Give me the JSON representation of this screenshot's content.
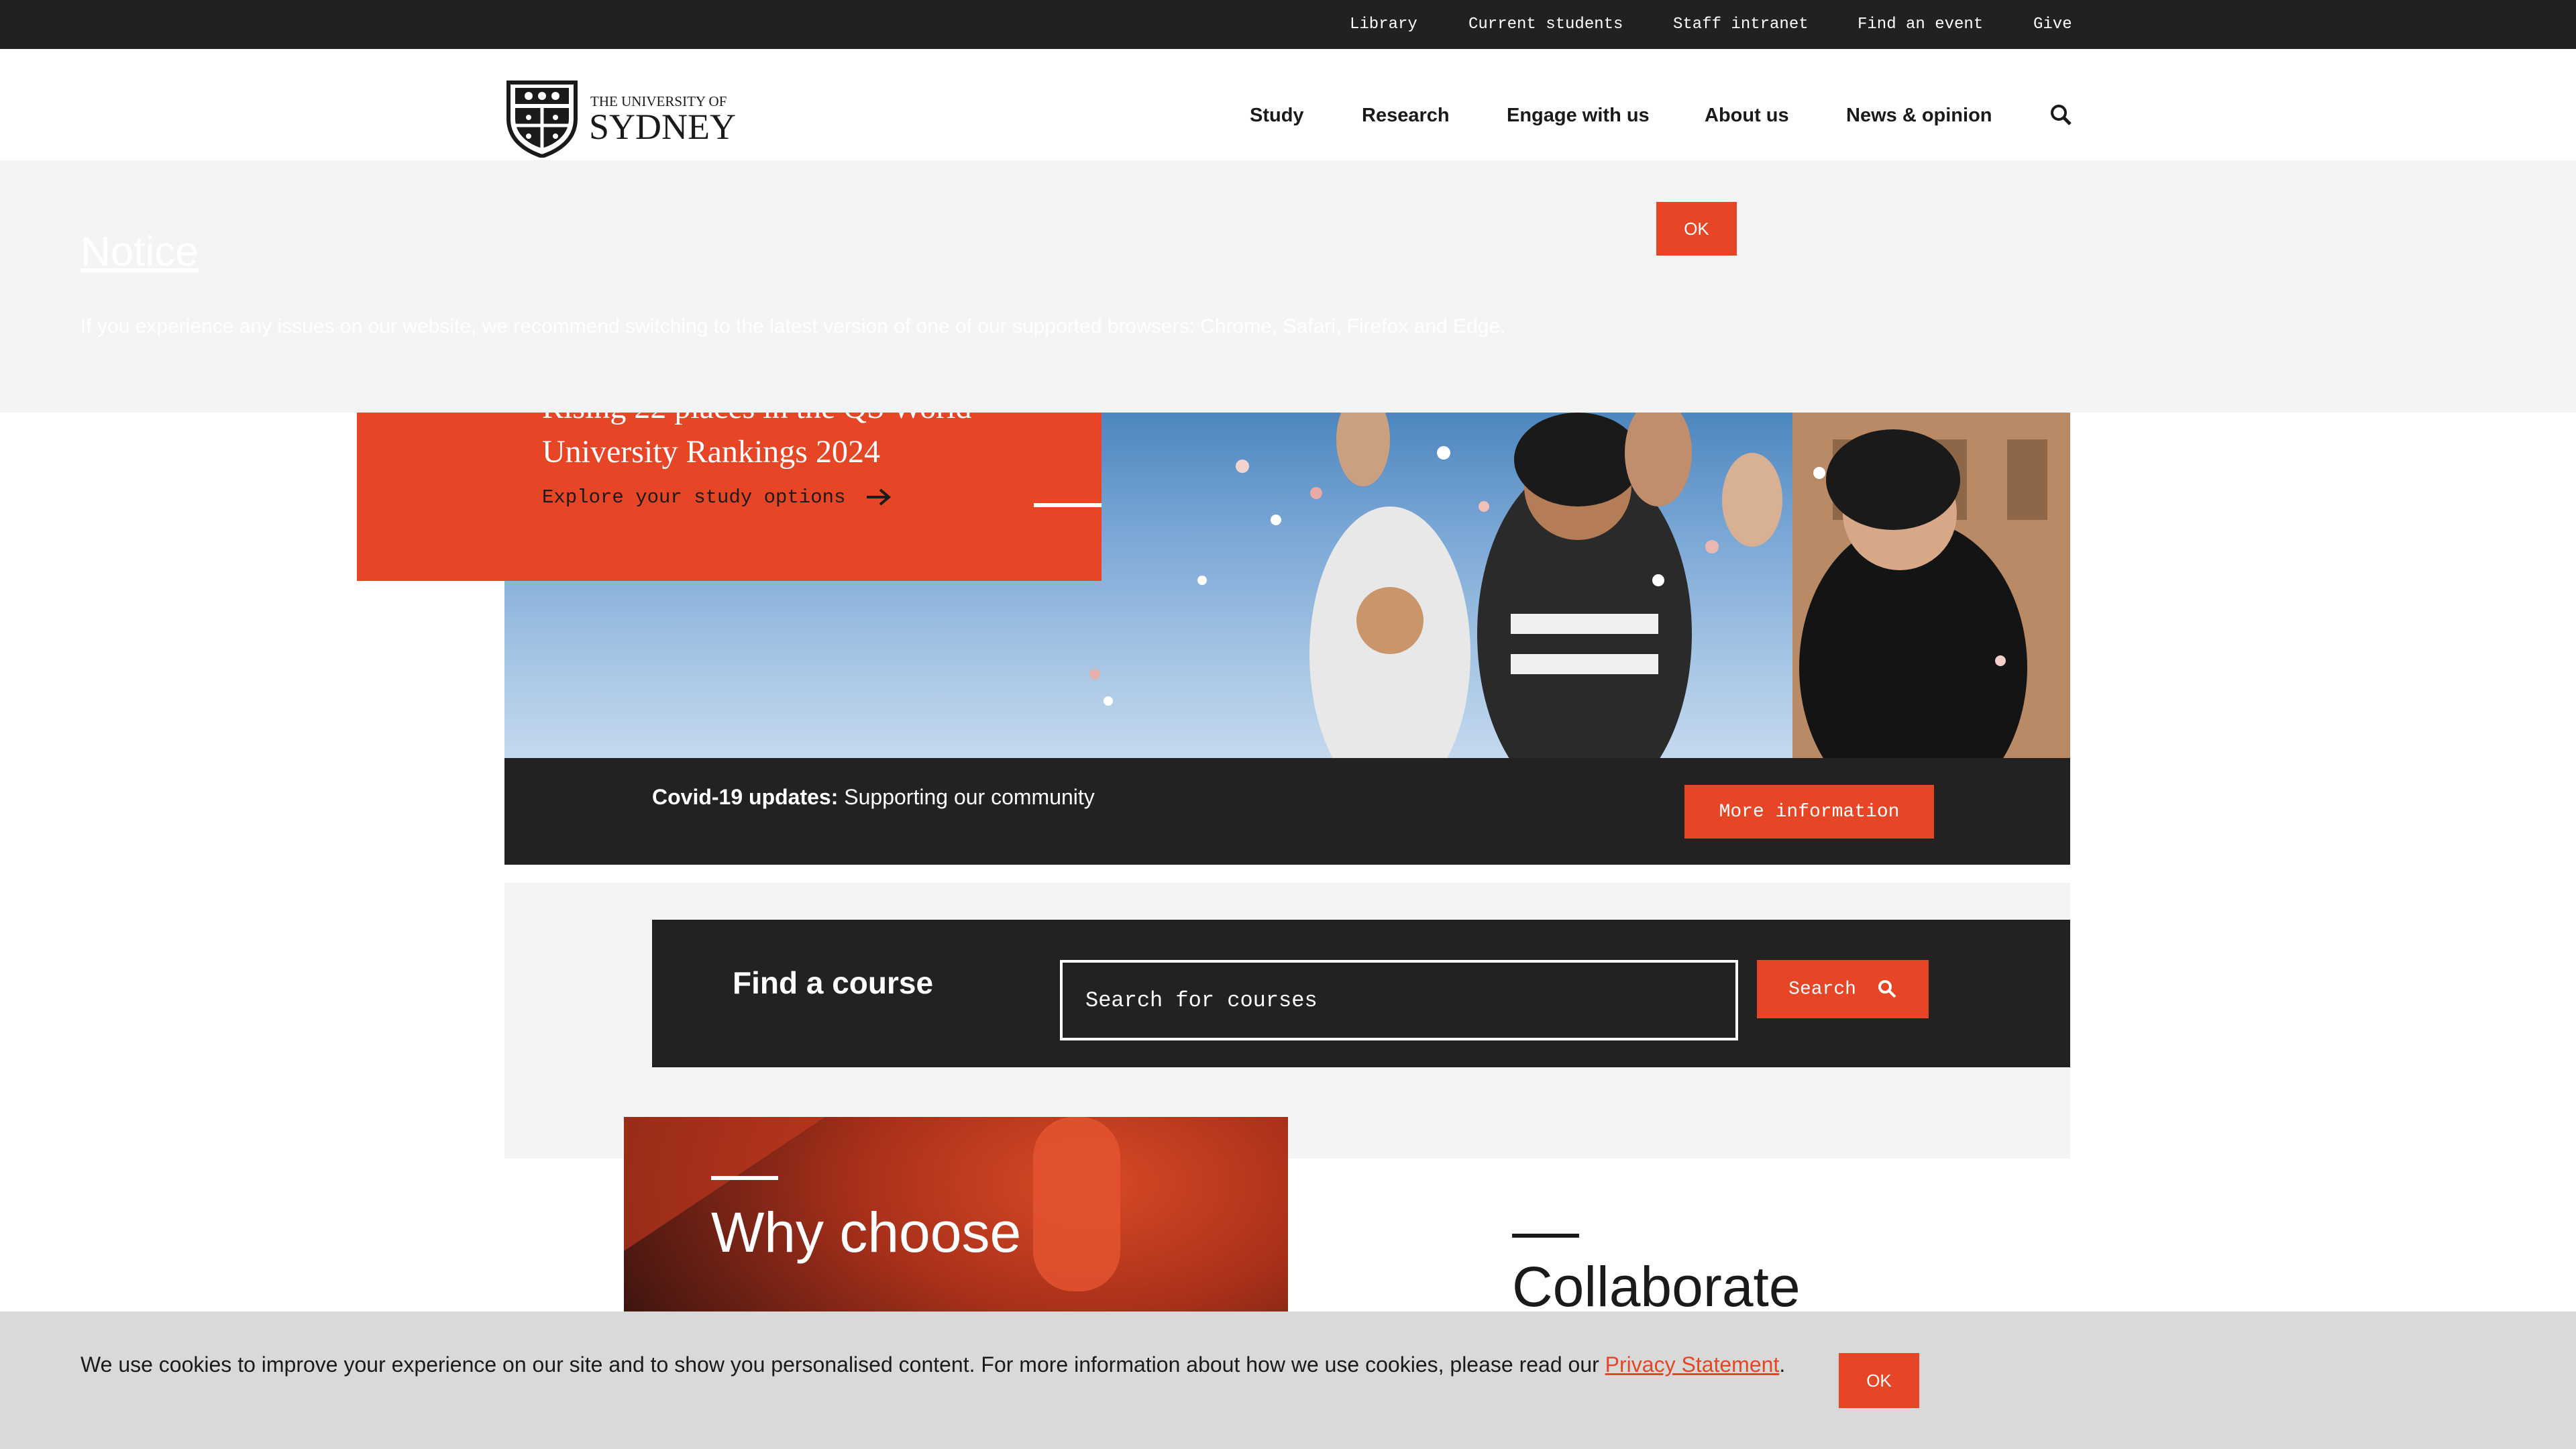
{
  "utility_nav": {
    "links": [
      "Library",
      "Current students",
      "Staff intranet",
      "Find an event",
      "Give"
    ]
  },
  "header": {
    "logo": {
      "line1": "THE UNIVERSITY OF",
      "line2": "SYDNEY"
    },
    "nav": [
      "Study",
      "Research",
      "Engage with us",
      "About us",
      "News & opinion"
    ],
    "search_icon": "search-icon"
  },
  "notice": {
    "title": "Notice",
    "text": "If you experience any issues on our website, we recommend switching to the latest version of one of our supported browsers: Chrome, Safari, Firefox and Edge.",
    "ok_label": "OK"
  },
  "hero": {
    "title": "Rising 22 places in the QS World University Rankings 2024",
    "link_label": "Explore your study options",
    "link_icon": "arrow-right-icon"
  },
  "covid": {
    "label": "Covid-19 updates:",
    "text": "Supporting our community",
    "button_label": "More information"
  },
  "find_course": {
    "title": "Find a course",
    "placeholder": "Search for courses",
    "button_label": "Search"
  },
  "why_choose": {
    "text": "Why choose"
  },
  "collaborate": {
    "text": "Collaborate"
  },
  "cookie": {
    "text": "We use cookies to improve your experience on our site and to show you personalised content. For more information about how we use cookies, please read our",
    "link_label": "Privacy Statement",
    "period": ".",
    "ok_label": "OK"
  },
  "colors": {
    "accent": "#e64626",
    "dark": "#222222",
    "utility_bg": "#212121",
    "light_bg": "#f4f4f4",
    "cookie_bg": "#d9d9d9"
  }
}
